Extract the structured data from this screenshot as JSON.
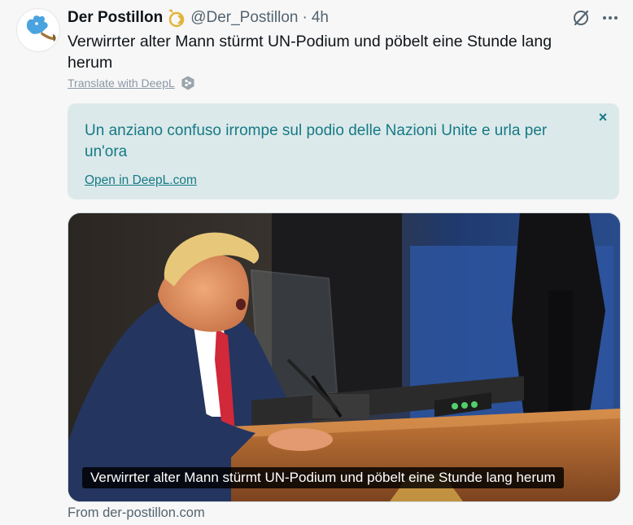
{
  "account": {
    "display_name": "Der Postillon",
    "handle": "@Der_Postillon",
    "separator": "·",
    "time": "4h",
    "avatar_icon": "bird-horn-icon",
    "badge_icon": "gold-affiliate-badge-icon"
  },
  "tweet": {
    "text": "Verwirrter alter Mann stürmt UN-Podium und pöbelt eine Stunde lang herum"
  },
  "translate": {
    "link_label": "Translate with DeepL",
    "icon": "deepl-icon"
  },
  "deepl": {
    "translation": "Un anziano confuso irrompe sul podio delle Nazioni Unite e urla per un'ora",
    "open_label": "Open in DeepL.com",
    "close_label": "×"
  },
  "card": {
    "caption": "Verwirrter alter Mann stürmt UN-Podium und pöbelt eine Stunde lang herum",
    "source": "From der-postillon.com"
  },
  "colors": {
    "deepl_text": "#157a86",
    "deepl_bg": "#dce9ea",
    "secondary_text": "#536471"
  }
}
